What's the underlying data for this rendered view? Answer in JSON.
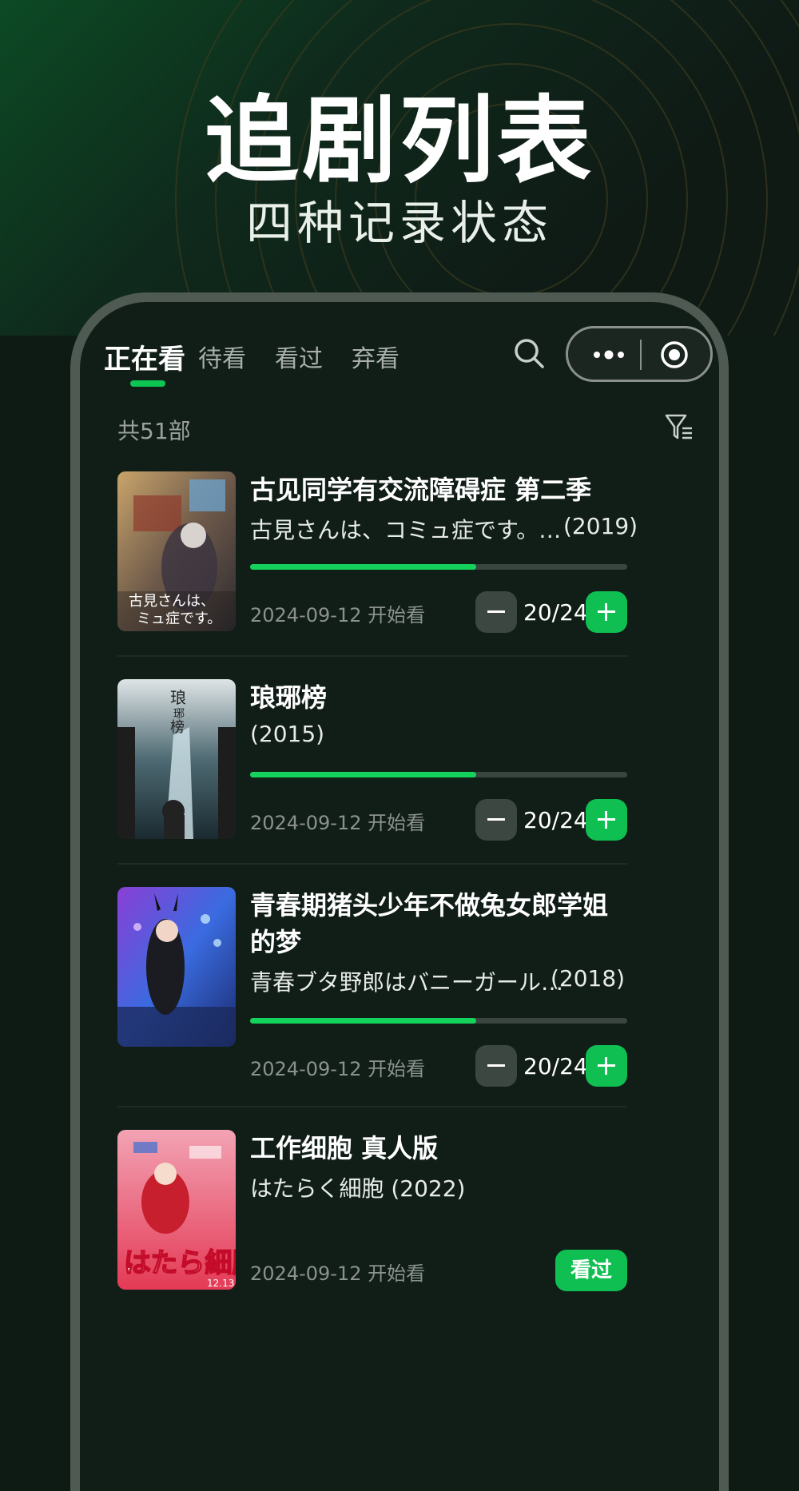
{
  "hero": {
    "title": "追剧列表",
    "subtitle": "四种记录状态"
  },
  "tabs": [
    "正在看",
    "待看",
    "看过",
    "弃看"
  ],
  "count_text": "共51部",
  "items": [
    {
      "title": "古见同学有交流障碍症 第二季",
      "subtitle": "古見さんは、コミュ症です。…",
      "year": "(2019)",
      "start_date": "2024-09-12 开始看",
      "progress": 0.6,
      "episode": "20/24"
    },
    {
      "title": "琅琊榜",
      "subtitle": "(2015)",
      "year": "",
      "start_date": "2024-09-12 开始看",
      "progress": 0.6,
      "episode": "20/24"
    },
    {
      "title": "青春期猪头少年不做兔女郎学姐的梦",
      "subtitle": "青春ブタ野郎はバニーガール…",
      "year": "(2018)",
      "start_date": "2024-09-12 开始看",
      "progress": 0.6,
      "episode": "20/24"
    },
    {
      "title": "工作细胞 真人版",
      "subtitle": "はたらく細胞 (2022)",
      "year": "",
      "start_date": "2024-09-12 开始看",
      "watched_label": "看过"
    }
  ],
  "colors": {
    "accent": "#0fbf52",
    "background": "#111e18"
  }
}
